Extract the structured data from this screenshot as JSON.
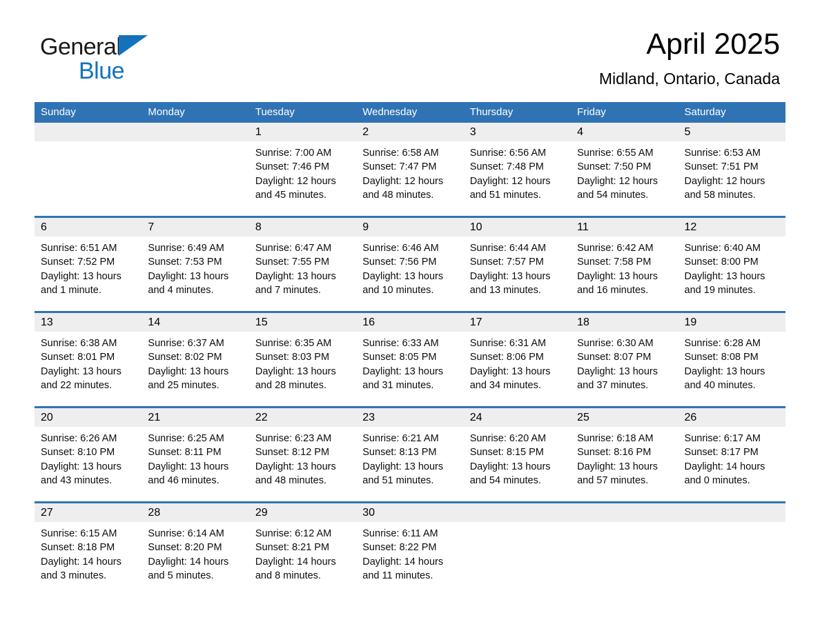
{
  "brand": {
    "word1": "General",
    "word2": "Blue",
    "triangle_color": "#1272bc"
  },
  "header": {
    "title": "April 2025",
    "location": "Midland, Ontario, Canada"
  },
  "theme": {
    "header_blue": "#3073b5",
    "date_strip_gray": "#eeeeee",
    "rule_blue": "#3073b5"
  },
  "weekdays": [
    "Sunday",
    "Monday",
    "Tuesday",
    "Wednesday",
    "Thursday",
    "Friday",
    "Saturday"
  ],
  "weeks": [
    [
      {
        "day": "",
        "empty": true
      },
      {
        "day": "",
        "empty": true
      },
      {
        "day": "1",
        "sunrise": "Sunrise: 7:00 AM",
        "sunset": "Sunset: 7:46 PM",
        "daylight": "Daylight: 12 hours and 45 minutes."
      },
      {
        "day": "2",
        "sunrise": "Sunrise: 6:58 AM",
        "sunset": "Sunset: 7:47 PM",
        "daylight": "Daylight: 12 hours and 48 minutes."
      },
      {
        "day": "3",
        "sunrise": "Sunrise: 6:56 AM",
        "sunset": "Sunset: 7:48 PM",
        "daylight": "Daylight: 12 hours and 51 minutes."
      },
      {
        "day": "4",
        "sunrise": "Sunrise: 6:55 AM",
        "sunset": "Sunset: 7:50 PM",
        "daylight": "Daylight: 12 hours and 54 minutes."
      },
      {
        "day": "5",
        "sunrise": "Sunrise: 6:53 AM",
        "sunset": "Sunset: 7:51 PM",
        "daylight": "Daylight: 12 hours and 58 minutes."
      }
    ],
    [
      {
        "day": "6",
        "sunrise": "Sunrise: 6:51 AM",
        "sunset": "Sunset: 7:52 PM",
        "daylight": "Daylight: 13 hours and 1 minute."
      },
      {
        "day": "7",
        "sunrise": "Sunrise: 6:49 AM",
        "sunset": "Sunset: 7:53 PM",
        "daylight": "Daylight: 13 hours and 4 minutes."
      },
      {
        "day": "8",
        "sunrise": "Sunrise: 6:47 AM",
        "sunset": "Sunset: 7:55 PM",
        "daylight": "Daylight: 13 hours and 7 minutes."
      },
      {
        "day": "9",
        "sunrise": "Sunrise: 6:46 AM",
        "sunset": "Sunset: 7:56 PM",
        "daylight": "Daylight: 13 hours and 10 minutes."
      },
      {
        "day": "10",
        "sunrise": "Sunrise: 6:44 AM",
        "sunset": "Sunset: 7:57 PM",
        "daylight": "Daylight: 13 hours and 13 minutes."
      },
      {
        "day": "11",
        "sunrise": "Sunrise: 6:42 AM",
        "sunset": "Sunset: 7:58 PM",
        "daylight": "Daylight: 13 hours and 16 minutes."
      },
      {
        "day": "12",
        "sunrise": "Sunrise: 6:40 AM",
        "sunset": "Sunset: 8:00 PM",
        "daylight": "Daylight: 13 hours and 19 minutes."
      }
    ],
    [
      {
        "day": "13",
        "sunrise": "Sunrise: 6:38 AM",
        "sunset": "Sunset: 8:01 PM",
        "daylight": "Daylight: 13 hours and 22 minutes."
      },
      {
        "day": "14",
        "sunrise": "Sunrise: 6:37 AM",
        "sunset": "Sunset: 8:02 PM",
        "daylight": "Daylight: 13 hours and 25 minutes."
      },
      {
        "day": "15",
        "sunrise": "Sunrise: 6:35 AM",
        "sunset": "Sunset: 8:03 PM",
        "daylight": "Daylight: 13 hours and 28 minutes."
      },
      {
        "day": "16",
        "sunrise": "Sunrise: 6:33 AM",
        "sunset": "Sunset: 8:05 PM",
        "daylight": "Daylight: 13 hours and 31 minutes."
      },
      {
        "day": "17",
        "sunrise": "Sunrise: 6:31 AM",
        "sunset": "Sunset: 8:06 PM",
        "daylight": "Daylight: 13 hours and 34 minutes."
      },
      {
        "day": "18",
        "sunrise": "Sunrise: 6:30 AM",
        "sunset": "Sunset: 8:07 PM",
        "daylight": "Daylight: 13 hours and 37 minutes."
      },
      {
        "day": "19",
        "sunrise": "Sunrise: 6:28 AM",
        "sunset": "Sunset: 8:08 PM",
        "daylight": "Daylight: 13 hours and 40 minutes."
      }
    ],
    [
      {
        "day": "20",
        "sunrise": "Sunrise: 6:26 AM",
        "sunset": "Sunset: 8:10 PM",
        "daylight": "Daylight: 13 hours and 43 minutes."
      },
      {
        "day": "21",
        "sunrise": "Sunrise: 6:25 AM",
        "sunset": "Sunset: 8:11 PM",
        "daylight": "Daylight: 13 hours and 46 minutes."
      },
      {
        "day": "22",
        "sunrise": "Sunrise: 6:23 AM",
        "sunset": "Sunset: 8:12 PM",
        "daylight": "Daylight: 13 hours and 48 minutes."
      },
      {
        "day": "23",
        "sunrise": "Sunrise: 6:21 AM",
        "sunset": "Sunset: 8:13 PM",
        "daylight": "Daylight: 13 hours and 51 minutes."
      },
      {
        "day": "24",
        "sunrise": "Sunrise: 6:20 AM",
        "sunset": "Sunset: 8:15 PM",
        "daylight": "Daylight: 13 hours and 54 minutes."
      },
      {
        "day": "25",
        "sunrise": "Sunrise: 6:18 AM",
        "sunset": "Sunset: 8:16 PM",
        "daylight": "Daylight: 13 hours and 57 minutes."
      },
      {
        "day": "26",
        "sunrise": "Sunrise: 6:17 AM",
        "sunset": "Sunset: 8:17 PM",
        "daylight": "Daylight: 14 hours and 0 minutes."
      }
    ],
    [
      {
        "day": "27",
        "sunrise": "Sunrise: 6:15 AM",
        "sunset": "Sunset: 8:18 PM",
        "daylight": "Daylight: 14 hours and 3 minutes."
      },
      {
        "day": "28",
        "sunrise": "Sunrise: 6:14 AM",
        "sunset": "Sunset: 8:20 PM",
        "daylight": "Daylight: 14 hours and 5 minutes."
      },
      {
        "day": "29",
        "sunrise": "Sunrise: 6:12 AM",
        "sunset": "Sunset: 8:21 PM",
        "daylight": "Daylight: 14 hours and 8 minutes."
      },
      {
        "day": "30",
        "sunrise": "Sunrise: 6:11 AM",
        "sunset": "Sunset: 8:22 PM",
        "daylight": "Daylight: 14 hours and 11 minutes."
      },
      {
        "day": "",
        "empty": true
      },
      {
        "day": "",
        "empty": true
      },
      {
        "day": "",
        "empty": true
      }
    ]
  ]
}
